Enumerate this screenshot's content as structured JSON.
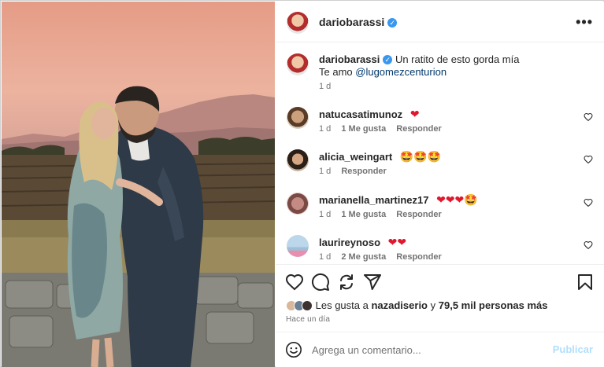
{
  "post": {
    "author": "dariobarassi",
    "verified_mark": "✓",
    "more_label": "•••"
  },
  "caption": {
    "author": "dariobarassi",
    "text": "Un ratito de esto gorda mía",
    "line2_prefix": "Te amo",
    "mention": "@lugomezcenturion",
    "time": "1 d"
  },
  "comments": [
    {
      "user": "natucasatimunoz",
      "text": "❤",
      "time": "1 d",
      "likes": "1 Me gusta",
      "reply": "Responder"
    },
    {
      "user": "alicia_weingart",
      "text": "🤩🤩🤩",
      "time": "1 d",
      "likes": "",
      "reply": "Responder"
    },
    {
      "user": "marianella_martinez17",
      "text": "❤❤❤🤩",
      "time": "1 d",
      "likes": "1 Me gusta",
      "reply": "Responder"
    },
    {
      "user": "laurireynoso",
      "text": "❤❤",
      "time": "1 d",
      "likes": "2 Me gusta",
      "reply": "Responder"
    }
  ],
  "actions": {
    "icons": [
      "heart-icon",
      "comment-icon",
      "share-icon",
      "send-icon",
      "bookmark-icon"
    ]
  },
  "likes": {
    "prefix": "Les gusta a",
    "user": "nazadiserio",
    "conjunction": "y",
    "count": "79,5 mil personas más"
  },
  "posted": "Hace un día",
  "add_comment": {
    "placeholder": "Agrega un comentario...",
    "publish_label": "Publicar"
  },
  "colors": {
    "accent": "#0095f6",
    "publish_disabled": "#b2dffc",
    "heart": "#e0182d",
    "mention": "#00376b"
  }
}
